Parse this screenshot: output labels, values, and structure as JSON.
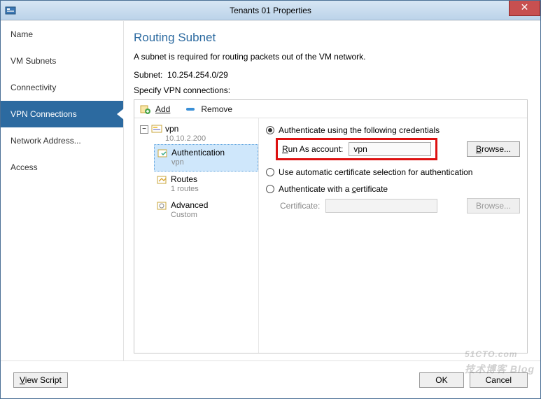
{
  "window": {
    "title": "Tenants 01 Properties"
  },
  "sidebar": {
    "items": [
      {
        "label": "Name"
      },
      {
        "label": "VM Subnets"
      },
      {
        "label": "Connectivity"
      },
      {
        "label": "VPN Connections"
      },
      {
        "label": "Network Address..."
      },
      {
        "label": "Access"
      }
    ],
    "active_index": 3
  },
  "page": {
    "title": "Routing Subnet",
    "description": "A subnet is required for routing packets out of the VM network.",
    "subnet_label": "Subnet:",
    "subnet_value": "10.254.254.0/29",
    "specify_label": "Specify VPN connections:"
  },
  "toolbar": {
    "add_label": "Add",
    "remove_label": "Remove"
  },
  "tree": {
    "root": {
      "label": "vpn",
      "sub": "10.10.2.200"
    },
    "children": [
      {
        "label": "Authentication",
        "sub": "vpn",
        "selected": true
      },
      {
        "label": "Routes",
        "sub": "1 routes"
      },
      {
        "label": "Advanced",
        "sub": "Custom"
      }
    ]
  },
  "details": {
    "opt1_label": "Authenticate using the following credentials",
    "runas_label_pre": "R",
    "runas_label_post": "un As account:",
    "runas_value": "vpn",
    "browse_label_pre": "B",
    "browse_label_post": "rowse...",
    "opt2_label": "Use automatic certificate selection for authentication",
    "opt3_label_pre": "Authenticate with a ",
    "opt3_hot": "c",
    "opt3_label_post": "ertificate",
    "cert_label": "Certificate:",
    "browse2_pre": "B",
    "browse2_post": "rowse..."
  },
  "footer": {
    "view_script_hot": "V",
    "view_script_post": "iew Script",
    "ok_label": "OK",
    "cancel_label": "Cancel"
  },
  "watermark": {
    "main": "51CTO.com",
    "sub": "技术博客  Blog"
  }
}
